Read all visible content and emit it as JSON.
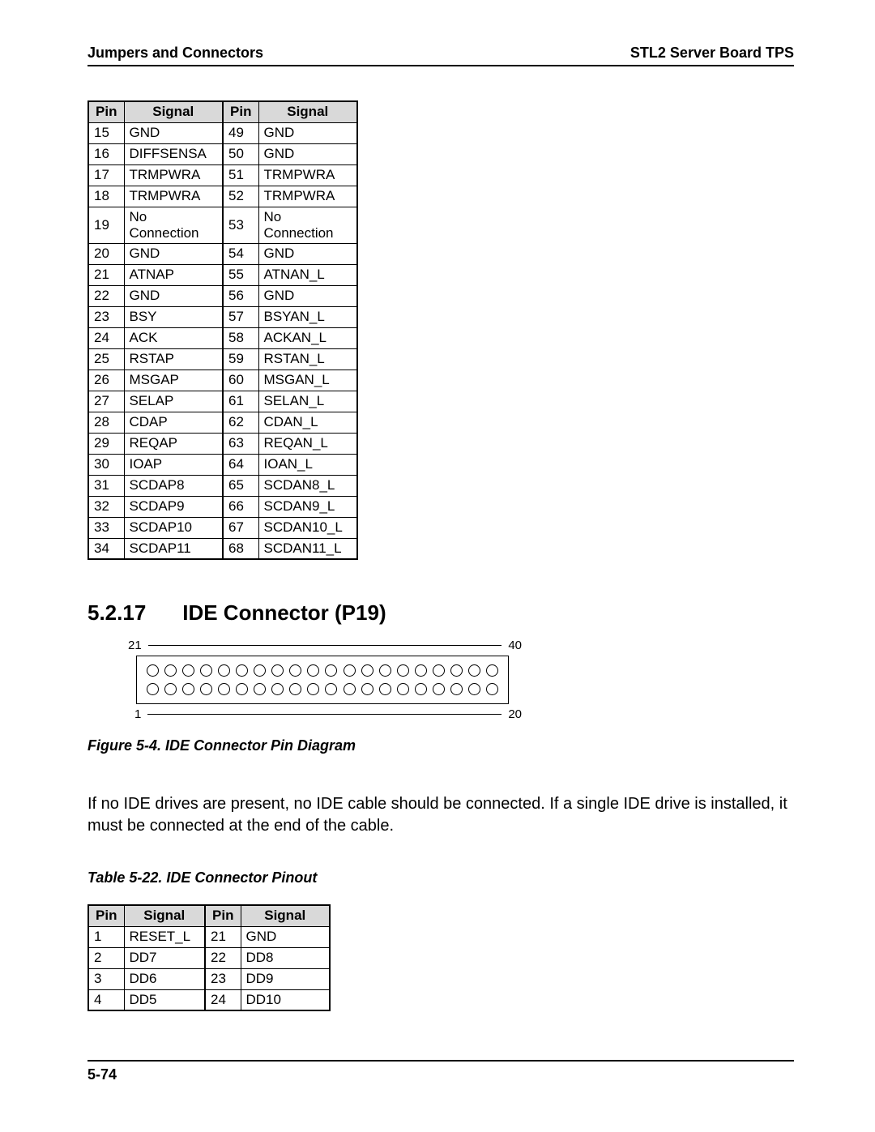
{
  "header": {
    "left": "Jumpers and Connectors",
    "right": "STL2 Server Board TPS"
  },
  "table1": {
    "headers": [
      "Pin",
      "Signal",
      "Pin",
      "Signal"
    ],
    "rows": [
      [
        "15",
        "GND",
        "49",
        "GND"
      ],
      [
        "16",
        "DIFFSENSA",
        "50",
        "GND"
      ],
      [
        "17",
        "TRMPWRA",
        "51",
        "TRMPWRA"
      ],
      [
        "18",
        "TRMPWRA",
        "52",
        "TRMPWRA"
      ],
      [
        "19",
        "No Connection",
        "53",
        "No Connection"
      ],
      [
        "20",
        "GND",
        "54",
        "GND"
      ],
      [
        "21",
        "ATNAP",
        "55",
        "ATNAN_L"
      ],
      [
        "22",
        "GND",
        "56",
        "GND"
      ],
      [
        "23",
        "BSY",
        "57",
        "BSYAN_L"
      ],
      [
        "24",
        "ACK",
        "58",
        "ACKAN_L"
      ],
      [
        "25",
        "RSTAP",
        "59",
        "RSTAN_L"
      ],
      [
        "26",
        "MSGAP",
        "60",
        "MSGAN_L"
      ],
      [
        "27",
        "SELAP",
        "61",
        "SELAN_L"
      ],
      [
        "28",
        "CDAP",
        "62",
        "CDAN_L"
      ],
      [
        "29",
        "REQAP",
        "63",
        "REQAN_L"
      ],
      [
        "30",
        "IOAP",
        "64",
        "IOAN_L"
      ],
      [
        "31",
        "SCDAP8",
        "65",
        "SCDAN8_L"
      ],
      [
        "32",
        "SCDAP9",
        "66",
        "SCDAN9_L"
      ],
      [
        "33",
        "SCDAP10",
        "67",
        "SCDAN10_L"
      ],
      [
        "34",
        "SCDAP11",
        "68",
        "SCDAN11_L"
      ]
    ]
  },
  "section": {
    "number": "5.2.17",
    "title": "IDE Connector (P19)"
  },
  "figure": {
    "pins_per_row": 20,
    "labels": {
      "top_left": "21",
      "top_right": "40",
      "bottom_left": "1",
      "bottom_right": "20"
    },
    "caption": "Figure 5-4. IDE Connector Pin Diagram"
  },
  "body_text": "If no IDE drives are present, no IDE cable should be connected. If a single IDE drive is installed, it must be connected at the end of the cable.",
  "table2_caption": "Table 5-22. IDE Connector Pinout",
  "table2": {
    "headers": [
      "Pin",
      "Signal",
      "Pin",
      "Signal"
    ],
    "rows": [
      [
        "1",
        "RESET_L",
        "21",
        "GND"
      ],
      [
        "2",
        "DD7",
        "22",
        "DD8"
      ],
      [
        "3",
        "DD6",
        "23",
        "DD9"
      ],
      [
        "4",
        "DD5",
        "24",
        "DD10"
      ]
    ]
  },
  "footer": {
    "page": "5-74"
  }
}
